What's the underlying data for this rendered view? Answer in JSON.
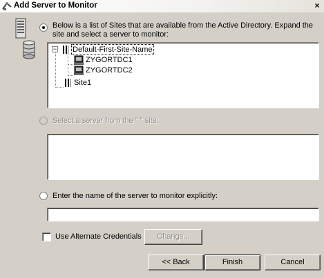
{
  "window": {
    "title": "Add Server to Monitor",
    "close_glyph": "×"
  },
  "option_sites": {
    "label_line1": "Below is a list of Sites that are available from the Active Directory.  Expand the",
    "label_line2": "site and select a server to monitor:",
    "selected": true
  },
  "tree": {
    "expander_glyph": "−",
    "items": [
      {
        "label": "Default-First-Site-Name",
        "icon": "site-icon",
        "level": 0,
        "expanded": true,
        "selected": true
      },
      {
        "label": "ZYGORTDC1",
        "icon": "server-icon",
        "level": 1
      },
      {
        "label": "ZYGORTDC2",
        "icon": "server-icon",
        "level": 1
      },
      {
        "label": "Site1",
        "icon": "site-icon",
        "level": 0
      }
    ]
  },
  "option_site_server": {
    "label": "Select a server from the \" \" site:",
    "selected": false,
    "disabled": true
  },
  "option_explicit": {
    "label": "Enter the name of the server to monitor explicitly:",
    "selected": false,
    "value": ""
  },
  "credentials": {
    "checkbox_label": "Use Alternate Credentials",
    "checked": false,
    "change_label": "Change..."
  },
  "buttons": {
    "back_label": "<< Back",
    "finish_label": "Finish",
    "cancel_label": "Cancel"
  },
  "colors": {
    "dialog_bg": "#d4d0c8",
    "disabled_text": "#8d8a84"
  }
}
